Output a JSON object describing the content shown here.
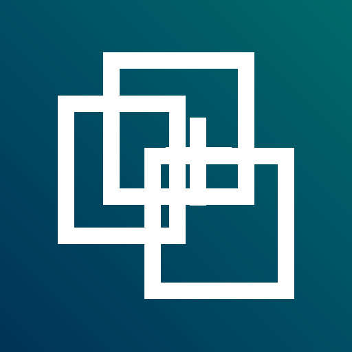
{
  "icon": {
    "name": "overlapping-squares-plus-logo",
    "background_colors": [
      "#003358",
      "#004e63",
      "#006a6a"
    ],
    "foreground_color": "#ffffff"
  }
}
